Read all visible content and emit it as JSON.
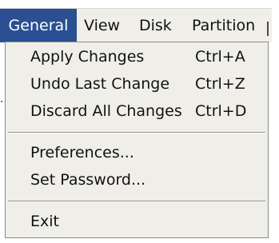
{
  "menubar": {
    "items": [
      "General",
      "View",
      "Disk",
      "Partition"
    ],
    "active": "General"
  },
  "menu": {
    "group1": [
      {
        "label": "Apply Changes",
        "shortcut": "Ctrl+A"
      },
      {
        "label": "Undo Last Change",
        "shortcut": "Ctrl+Z"
      },
      {
        "label": "Discard All Changes",
        "shortcut": "Ctrl+D"
      }
    ],
    "group2": [
      {
        "label": "Preferences..."
      },
      {
        "label": "Set Password..."
      }
    ],
    "group3": [
      {
        "label": "Exit"
      }
    ]
  },
  "colors": {
    "menu_background": "#efeee8",
    "active_highlight": "#2a4f92",
    "separator": "#8f8e8a"
  }
}
